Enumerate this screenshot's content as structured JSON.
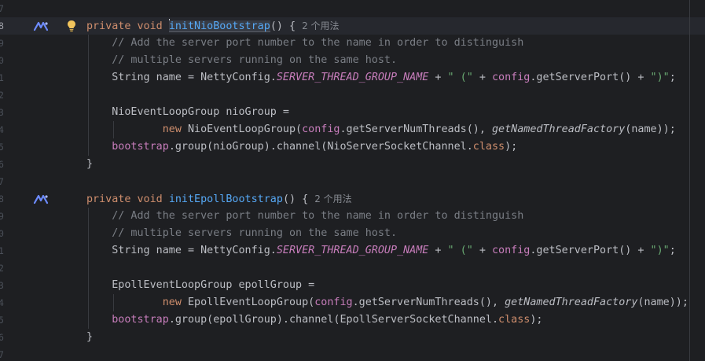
{
  "gutter": {
    "line_numbers": [
      "7",
      "8",
      "9",
      "0",
      "1",
      "2",
      "3",
      "4",
      "5",
      "6",
      "7",
      "8",
      "9",
      "0",
      "1",
      "2",
      "3",
      "4",
      "5",
      "6",
      "7"
    ],
    "current_line_index": 1
  },
  "code": {
    "usages_label": "2 个用法",
    "kw_private": "private",
    "kw_void": "void",
    "kw_new": "new",
    "kw_class": "class",
    "method1_name": "initNioBootstrap",
    "method2_name": "initEpollBootstrap",
    "sig_tail": "() {",
    "comment_line1": "// Add the server port number to the name in order to distinguish",
    "comment_line2": "// multiple servers running on the same host.",
    "string_decl": "String name = NettyConfig.",
    "server_const": "SERVER_THREAD_GROUP_NAME",
    "plus": " + ",
    "str_open": "\" (\"",
    "config_field": "config",
    "get_port_call": ".getServerPort() + ",
    "str_close": "\")\"",
    "semicolon": ";",
    "nio_group_decl": "NioEventLoopGroup nioGroup =",
    "epoll_group_decl": "EpollEventLoopGroup epollGroup =",
    "nio_ctor": "NioEventLoopGroup(",
    "epoll_ctor": "EpollEventLoopGroup(",
    "threads_call": ".getServerNumThreads(), ",
    "thread_factory": "getNamedThreadFactory",
    "name_arg_close": "(name));",
    "bootstrap_field": "bootstrap",
    "nio_channel": ".group(nioGroup).channel(NioServerSocketChannel.",
    "epoll_channel": ".group(epollGroup).channel(EpollServerSocketChannel.",
    "channel_close": ");",
    "close_brace": "}"
  },
  "colors": {
    "background": "#1e1f22",
    "keyword": "#cf8e6d",
    "method_declaration": "#56a8f5",
    "comment": "#7a7e85",
    "string": "#6aab73",
    "constant_field": "#c77dbb",
    "default_text": "#bcbec4"
  },
  "icons": {
    "gutter_ai_icon": "ai-assistant-icon",
    "intention_icon": "lightbulb-icon"
  }
}
